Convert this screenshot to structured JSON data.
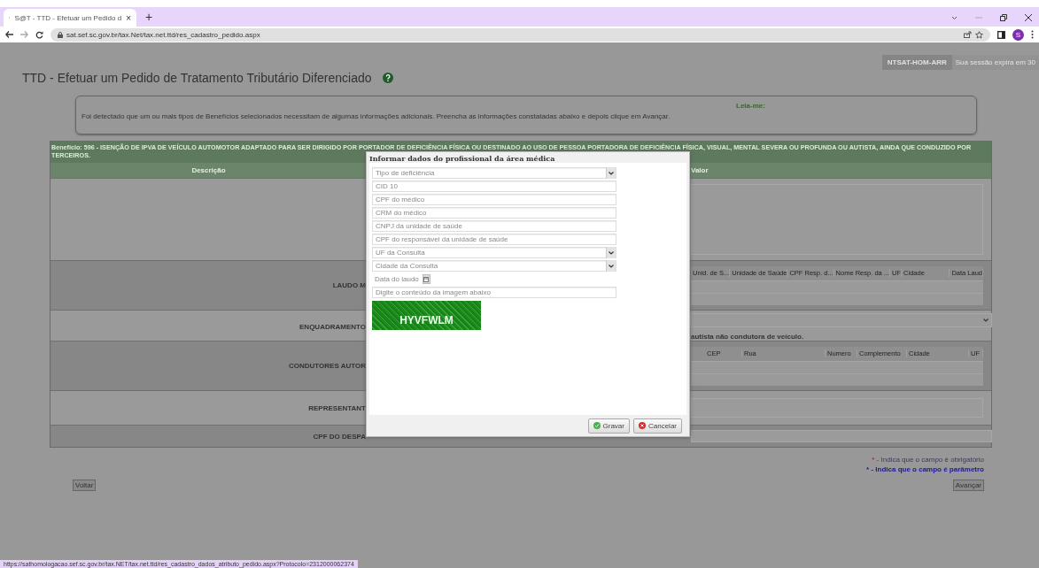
{
  "browser": {
    "tab_title": "S@T - TTD - Efetuar um Pedido d",
    "tab_close": "×",
    "new_tab": "+",
    "url": "sat.sef.sc.gov.br/tax.Net/tax.net.ttd/res_cadastro_pedido.aspx",
    "avatar": "S",
    "status_url": "https://sathomologacao.sef.sc.gov.br/tax.NET/tax.net.ttd/res_cadastro_dados_atributo_pedido.aspx?Protocolo=2312000062374"
  },
  "header": {
    "user_badge": "NTSAT-HOM-ARR",
    "session_text": "Sua sessão expira em 30",
    "title": "TTD - Efetuar um Pedido de Tratamento Tributário Diferenciado"
  },
  "info": {
    "label": "Leia-me:",
    "text": "Foi detectado que um ou mais tipos de Benefícios selecionados necessitam de algumas informações adicionais. Preencha as informações constatadas abaixo e depois clique em Avançar."
  },
  "benefit": {
    "text": "Benefício: 596 - ISENÇÃO DE IPVA DE VEÍCULO AUTOMOTOR ADAPTADO PARA SER DIRIGIDO POR PORTADOR DE DEFICIÊNCIA FÍSICA OU DESTINADO AO USO DE PESSOA PORTADORA DE DEFICIÊNCIA FÍSICA, VISUAL, MENTAL SEVERA OU PROFUNDA OU AUTISTA, AINDA QUE CONDUZIDO POR TERCEIROS."
  },
  "table": {
    "columns": [
      "Descrição",
      "Valor"
    ],
    "rows": [
      {
        "kind": "textarea"
      },
      {
        "kind": "grid",
        "label": "LAUDO M",
        "grid_columns": [
          "Unid. de S...",
          "Unidade de Saúde",
          "CPF Resp. d...",
          "Nome Resp. da ...",
          "UF",
          "Cidade",
          "Data Laud"
        ]
      },
      {
        "kind": "select",
        "label": "ENQUADRAMENTO",
        "note": "autista não condutora de veículo."
      },
      {
        "kind": "grid",
        "label": "CONDUTORES AUTOR",
        "grid_columns": [
          "CEP",
          "Rua",
          "Numero",
          "Complemento",
          "Cidade",
          "UF"
        ]
      },
      {
        "kind": "input",
        "label": "REPRESENTANT"
      },
      {
        "kind": "input_small",
        "label": "CPF DO DESPA"
      }
    ]
  },
  "legend": [
    {
      "kind": "required",
      "mark": "*",
      "text": "- Indica que o campo é obrigatório"
    },
    {
      "kind": "parameter",
      "mark": "*",
      "text": "- Indica que o campo é parâmetro"
    }
  ],
  "buttons": {
    "back": "Voltar",
    "next": "Avançar"
  },
  "modal": {
    "title": "Informar dados do profissional da área médica",
    "fields": [
      {
        "kind": "select",
        "placeholder": "Tipo de deficiência"
      },
      {
        "kind": "input",
        "placeholder": "CID 10"
      },
      {
        "kind": "input",
        "placeholder": "CPF do médico"
      },
      {
        "kind": "input",
        "placeholder": "CRM do médico"
      },
      {
        "kind": "input",
        "placeholder": "CNPJ da unidade de saúde"
      },
      {
        "kind": "input",
        "placeholder": "CPF do responsável da unidade de saúde"
      },
      {
        "kind": "select",
        "placeholder": "UF da Consulta"
      },
      {
        "kind": "select",
        "placeholder": "Cidade da Consulta"
      },
      {
        "kind": "date",
        "placeholder": "Data do laudo"
      },
      {
        "kind": "input",
        "placeholder": "Digite o conteúdo da imagem abaixo"
      }
    ],
    "captcha": "HYVFWLM",
    "buttons": [
      {
        "kind": "save",
        "label": "Gravar"
      },
      {
        "kind": "cancel",
        "label": "Cancelar"
      }
    ]
  }
}
